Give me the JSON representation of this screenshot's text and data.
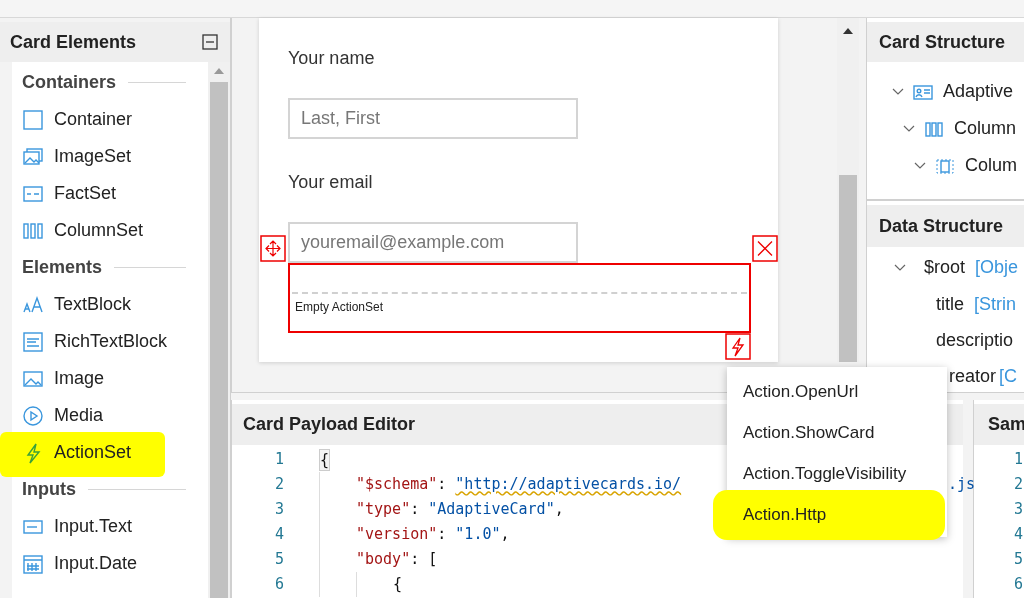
{
  "card_elements": {
    "title": "Card Elements",
    "groups": [
      {
        "label": "Containers",
        "items": [
          {
            "label": "Container",
            "highlighted": false
          },
          {
            "label": "ImageSet",
            "highlighted": false
          },
          {
            "label": "FactSet",
            "highlighted": false
          },
          {
            "label": "ColumnSet",
            "highlighted": false
          }
        ]
      },
      {
        "label": "Elements",
        "items": [
          {
            "label": "TextBlock",
            "highlighted": false
          },
          {
            "label": "RichTextBlock",
            "highlighted": false
          },
          {
            "label": "Image",
            "highlighted": false
          },
          {
            "label": "Media",
            "highlighted": false
          },
          {
            "label": "ActionSet",
            "highlighted": true
          }
        ]
      },
      {
        "label": "Inputs",
        "items": [
          {
            "label": "Input.Text",
            "highlighted": false
          },
          {
            "label": "Input.Date",
            "highlighted": false
          }
        ]
      }
    ]
  },
  "canvas": {
    "fields": [
      {
        "label": "Your name",
        "placeholder": "Last, First"
      },
      {
        "label": "Your email",
        "placeholder": "youremail@example.com"
      }
    ],
    "action_set": {
      "label": "Empty ActionSet",
      "selected": true
    }
  },
  "card_structure": {
    "title": "Card Structure",
    "tree": [
      {
        "label": "Adaptive",
        "expanded": true,
        "children": [
          {
            "label": "Column",
            "expanded": true,
            "children": [
              {
                "label": "Colum",
                "expanded": true
              }
            ]
          }
        ]
      }
    ]
  },
  "data_structure": {
    "title": "Data Structure",
    "tree": [
      {
        "label": "$root",
        "type": "[Obje",
        "expanded": true,
        "children": [
          {
            "label": "title",
            "type": "[Strin"
          },
          {
            "label": "descriptio"
          },
          {
            "label": "reator",
            "type": "[C"
          }
        ]
      }
    ]
  },
  "payload_editor": {
    "title": "Card Payload Editor",
    "lines": [
      {
        "number": "1",
        "tokens": [
          {
            "kind": "punct",
            "text": "{"
          }
        ]
      },
      {
        "number": "2",
        "tokens": [
          {
            "kind": "key",
            "text": "    \"$schema\""
          },
          {
            "kind": "punct",
            "text": ": "
          },
          {
            "kind": "link",
            "text": "\"http://adaptivecards.io/"
          }
        ],
        "tail": ".js"
      },
      {
        "number": "3",
        "tokens": [
          {
            "kind": "key",
            "text": "    \"type\""
          },
          {
            "kind": "punct",
            "text": ": "
          },
          {
            "kind": "string",
            "text": "\"AdaptiveCard\""
          },
          {
            "kind": "punct",
            "text": ","
          }
        ]
      },
      {
        "number": "4",
        "tokens": [
          {
            "kind": "key",
            "text": "    \"version\""
          },
          {
            "kind": "punct",
            "text": ": "
          },
          {
            "kind": "string",
            "text": "\"1.0\""
          },
          {
            "kind": "punct",
            "text": ","
          }
        ]
      },
      {
        "number": "5",
        "tokens": [
          {
            "kind": "key",
            "text": "    \"body\""
          },
          {
            "kind": "punct",
            "text": ": ["
          }
        ]
      },
      {
        "number": "6",
        "tokens": [
          {
            "kind": "punct",
            "text": "        {"
          }
        ]
      }
    ]
  },
  "add_action_menu": {
    "items": [
      {
        "label": "Action.OpenUrl",
        "highlighted": false
      },
      {
        "label": "Action.ShowCard",
        "highlighted": false
      },
      {
        "label": "Action.ToggleVisibility",
        "highlighted": false
      },
      {
        "label": "Action.Http",
        "highlighted": true
      }
    ]
  },
  "sample_panel": {
    "title": "Sam",
    "line_numbers": [
      "1",
      "2",
      "3",
      "4",
      "5",
      "6"
    ]
  }
}
